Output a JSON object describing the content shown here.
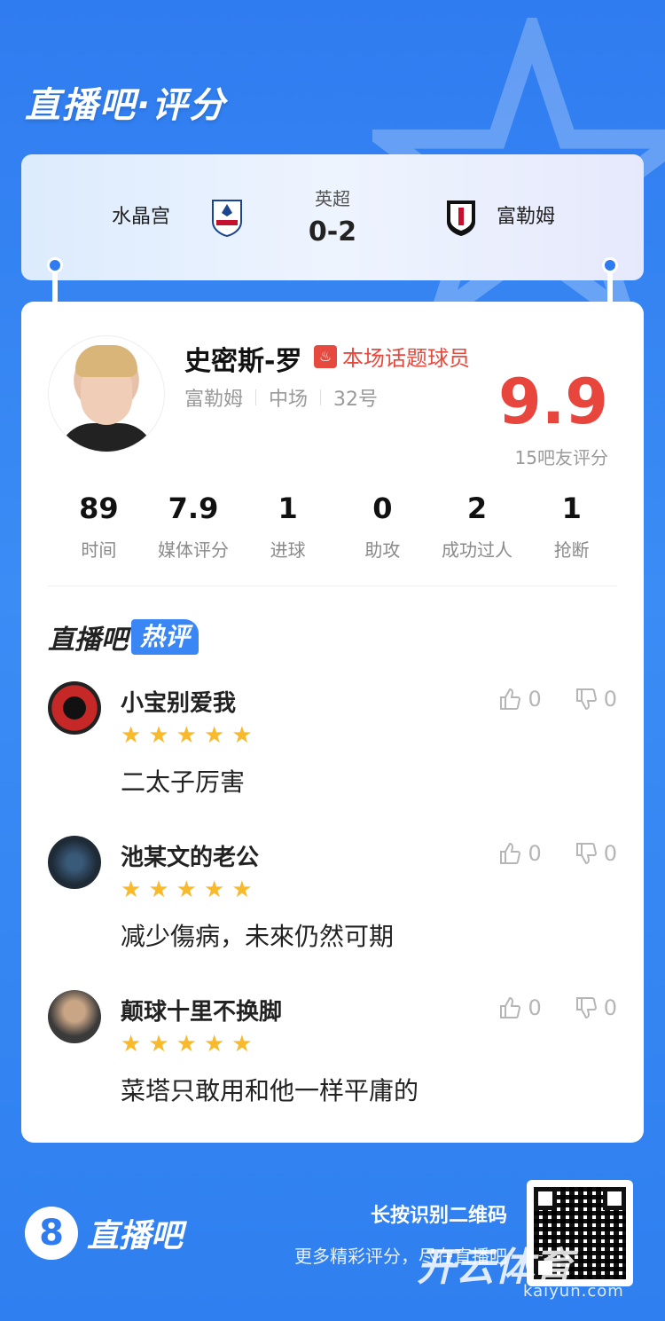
{
  "header": {
    "title": "直播吧·评分"
  },
  "match": {
    "league": "英超",
    "score": "0-2",
    "home_team": "水晶宫",
    "away_team": "富勒姆",
    "home_crest_icon": "crystal-palace-crest-icon",
    "away_crest_icon": "fulham-crest-icon"
  },
  "player": {
    "name": "史密斯-罗",
    "tag": "本场话题球员",
    "team": "富勒姆",
    "position": "中场",
    "number": "32号",
    "rating": "9.9",
    "rating_sub": "15吧友评分"
  },
  "stats": [
    {
      "value": "89",
      "label": "时间"
    },
    {
      "value": "7.9",
      "label": "媒体评分"
    },
    {
      "value": "1",
      "label": "进球"
    },
    {
      "value": "0",
      "label": "助攻"
    },
    {
      "value": "2",
      "label": "成功过人"
    },
    {
      "value": "1",
      "label": "抢断"
    }
  ],
  "hot_section": {
    "title_1": "直播吧",
    "title_2": "热评"
  },
  "comments": [
    {
      "user": "小宝别爱我",
      "stars": 5,
      "text": "二太子厉害",
      "likes": "0",
      "dislikes": "0"
    },
    {
      "user": "池某文的老公",
      "stars": 5,
      "text": "减少傷病，未來仍然可期",
      "likes": "0",
      "dislikes": "0"
    },
    {
      "user": "颠球十里不换脚",
      "stars": 5,
      "text": "菜塔只敢用和他一样平庸的",
      "likes": "0",
      "dislikes": "0"
    }
  ],
  "footer": {
    "logo_text": "直播吧",
    "logo_badge": "8",
    "cta": "长按识别二维码",
    "sub": "更多精彩评分，尽在直播吧",
    "watermark": "开云体育",
    "watermark_url": "kaiyun.com"
  },
  "colors": {
    "brand_blue": "#2f7cf0",
    "rating_red": "#e8453c",
    "star_yellow": "#f8b92c"
  }
}
